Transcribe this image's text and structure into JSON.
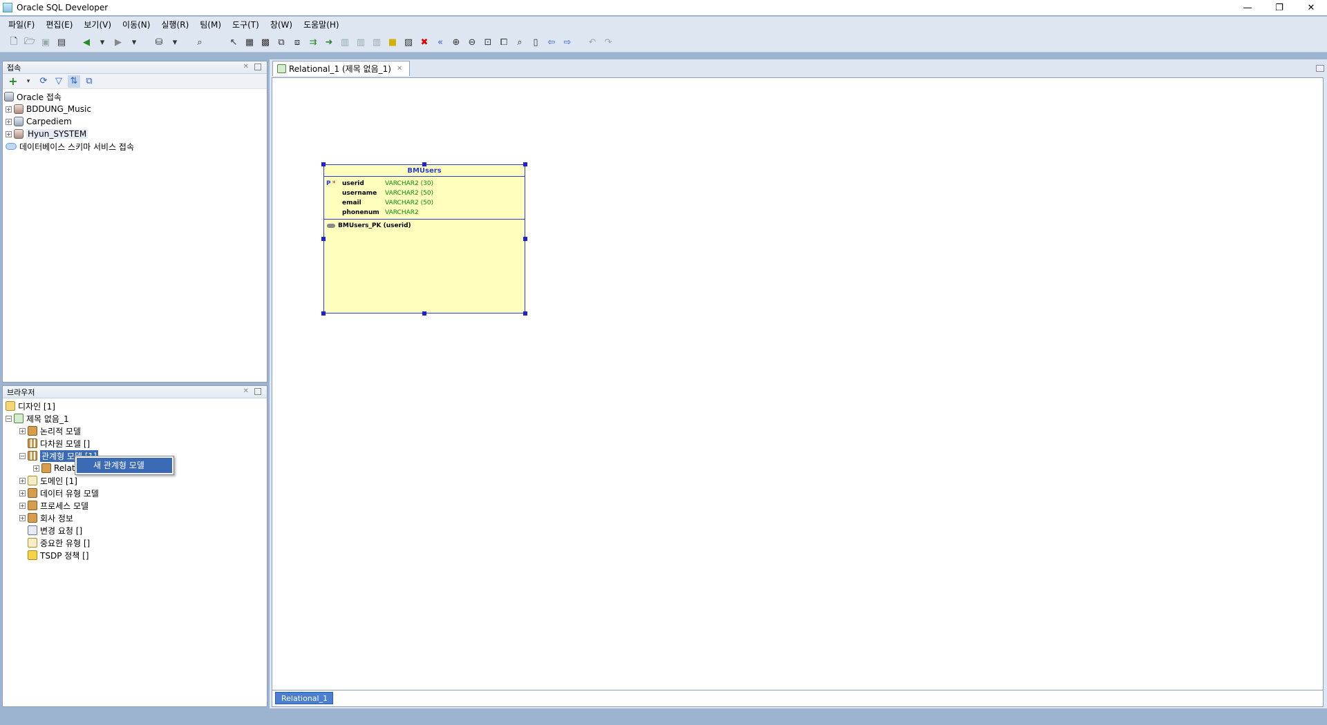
{
  "window": {
    "title": "Oracle SQL Developer",
    "controls": [
      "minimize",
      "restore",
      "close"
    ]
  },
  "menu": [
    "파일(F)",
    "편집(E)",
    "보기(V)",
    "이동(N)",
    "실행(R)",
    "팀(M)",
    "도구(T)",
    "창(W)",
    "도움말(H)"
  ],
  "connections_panel": {
    "title": "접속",
    "root": "Oracle 접속",
    "items": [
      "BDDUNG_Music",
      "Carpediem",
      "Hyun_SYSTEM"
    ],
    "cloud": "데이터베이스 스키마 서비스 접속"
  },
  "browser_panel": {
    "title": "브라우저",
    "design_root": "디자인 [1]",
    "design": "제목 없음_1",
    "items": {
      "logical": "논리적 모델",
      "multidim": "다차원 모델 []",
      "relational": "관계형 모델 [1]",
      "relational_child": "Relational_1",
      "domain": "도메인 [1]",
      "datatype": "데이터 유형 모델",
      "process": "프로세스 모델",
      "business": "회사 정보",
      "change": "변경 요청 []",
      "sensitive": "중요한 유형 []",
      "tsdp": "TSDP 정책 []"
    }
  },
  "context_menu": {
    "item": "새 관계형 모델"
  },
  "editor": {
    "tab": "Relational_1 (제목 없음_1)",
    "bottom_tab": "Relational_1"
  },
  "er_table": {
    "name": "BMUsers",
    "columns": [
      {
        "flag": "P",
        "mandatory": "*",
        "name": "userid",
        "type": "VARCHAR2 (30)"
      },
      {
        "flag": "",
        "mandatory": "",
        "name": "username",
        "type": "VARCHAR2 (50)"
      },
      {
        "flag": "",
        "mandatory": "",
        "name": "email",
        "type": "VARCHAR2 (50)"
      },
      {
        "flag": "",
        "mandatory": "",
        "name": "phonenum",
        "type": "VARCHAR2"
      }
    ],
    "key": "BMUsers_PK (userid)",
    "border_color": "#2b3bcf",
    "fill_color": "#fefebd"
  }
}
